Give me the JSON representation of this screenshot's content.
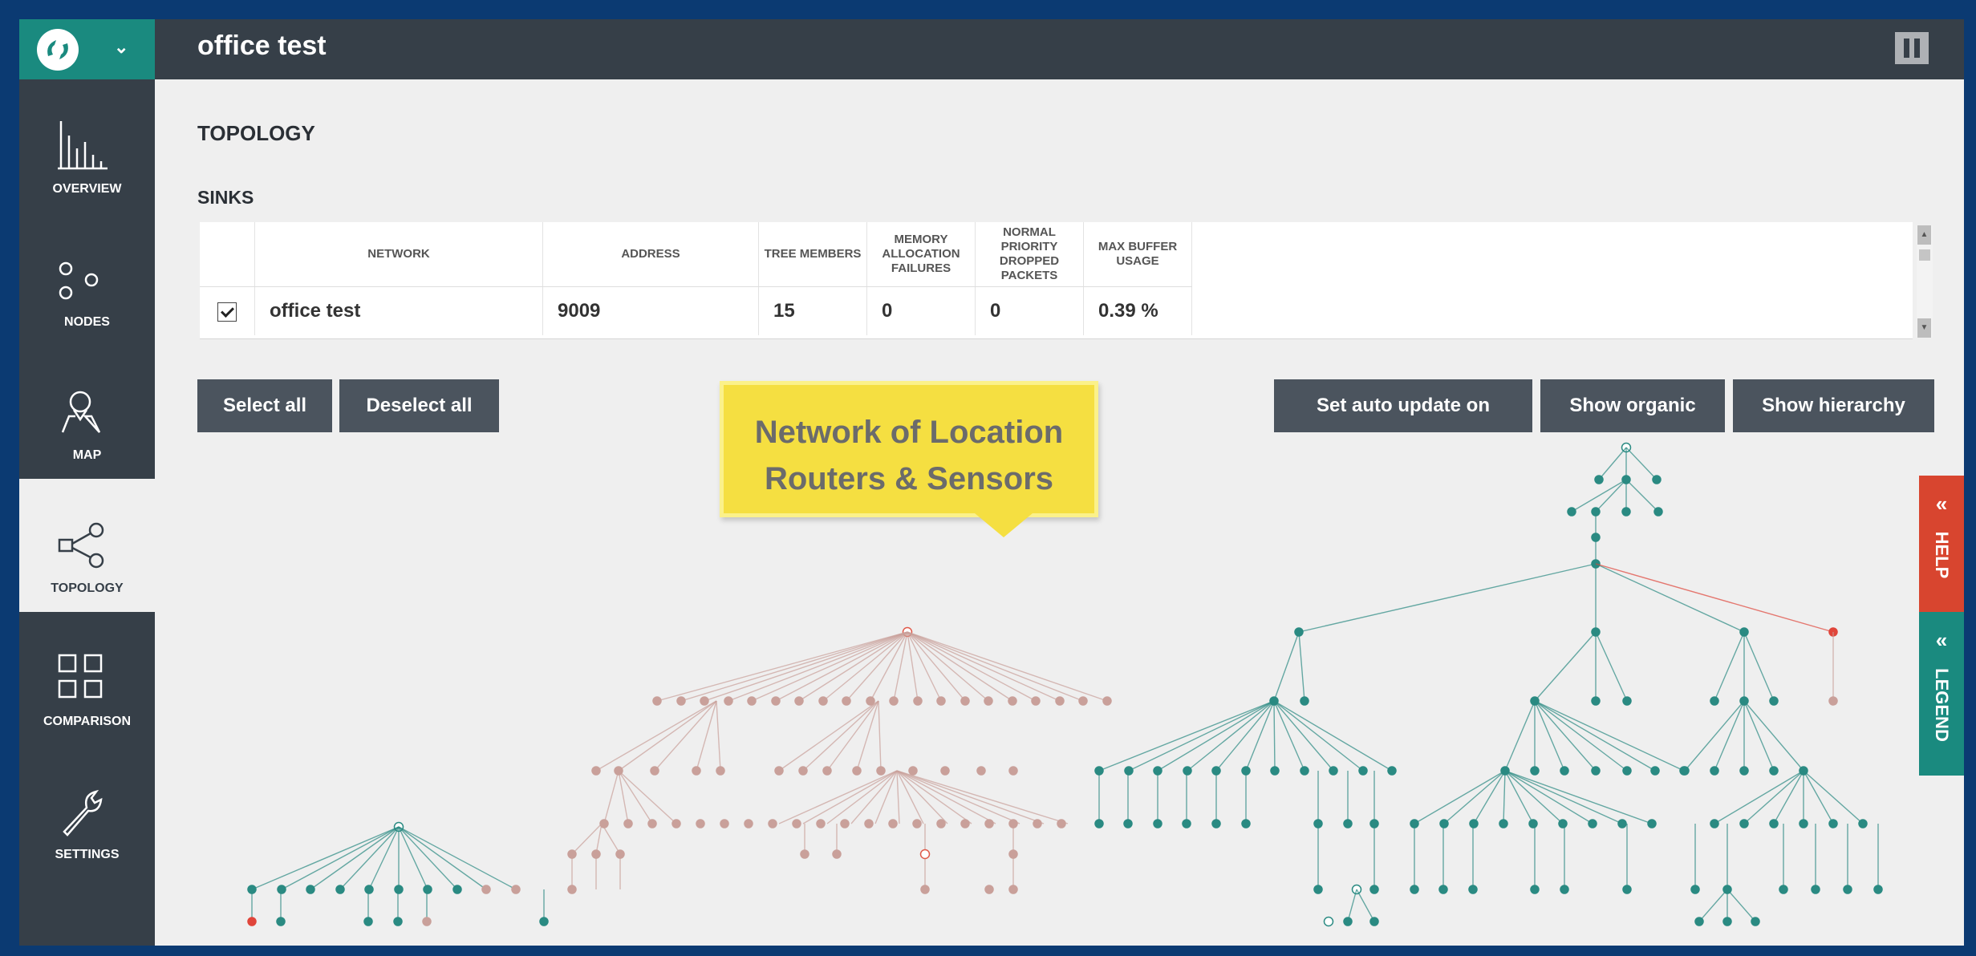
{
  "app": {
    "title": "office test"
  },
  "nav": [
    {
      "id": "overview",
      "label": "OVERVIEW",
      "icon": "bar-chart-icon"
    },
    {
      "id": "nodes",
      "label": "NODES",
      "icon": "nodes-icon"
    },
    {
      "id": "map",
      "label": "MAP",
      "icon": "map-pin-icon"
    },
    {
      "id": "topology",
      "label": "TOPOLOGY",
      "icon": "share-icon",
      "active": true
    },
    {
      "id": "comparison",
      "label": "COMPARISON",
      "icon": "grid-icon"
    },
    {
      "id": "settings",
      "label": "SETTINGS",
      "icon": "wrench-icon"
    }
  ],
  "page": {
    "heading": "TOPOLOGY",
    "sinks_heading": "SINKS"
  },
  "sinks_table": {
    "columns": [
      "",
      "NETWORK",
      "ADDRESS",
      "TREE MEMBERS",
      "MEMORY ALLOCATION FAILURES",
      "NORMAL PRIORITY DROPPED PACKETS",
      "MAX BUFFER USAGE"
    ],
    "rows": [
      {
        "checked": true,
        "network": "office test",
        "address": "9009",
        "tree_members": "15",
        "memory_failures": "0",
        "dropped_packets": "0",
        "max_buffer": "0.39 %"
      }
    ]
  },
  "buttons": {
    "select_all": "Select all",
    "deselect_all": "Deselect all",
    "auto_update": "Set auto update on",
    "show_organic": "Show organic",
    "show_hierarchy": "Show hierarchy"
  },
  "callout": {
    "line1": "Network of Location",
    "line2": "Routers & Sensors"
  },
  "side_tabs": {
    "help": "HELP",
    "legend": "LEGEND"
  },
  "colors": {
    "sidebar": "#363f48",
    "brand": "#1a8a7f",
    "node_teal": "#2a8a82",
    "node_pink": "#c9a09a",
    "alert_red": "#e0453a",
    "help_tab": "#d8452f",
    "legend_tab": "#1a8a7f",
    "callout": "#f5df41"
  }
}
